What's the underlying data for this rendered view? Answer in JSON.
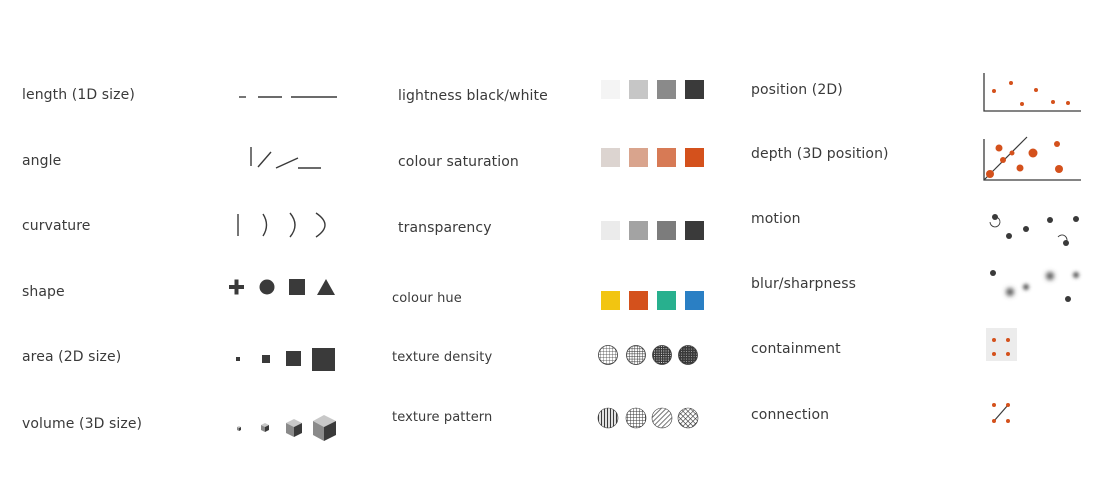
{
  "column1": {
    "labels": [
      "length (1D size)",
      "angle",
      "curvature",
      "shape",
      "area (2D size)",
      "volume (3D size)"
    ]
  },
  "column2": {
    "labels": [
      "lightness black/white",
      "colour saturation",
      "transparency",
      "colour hue",
      "texture density",
      "texture pattern"
    ]
  },
  "column3": {
    "labels": [
      "position (2D)",
      "depth (3D position)",
      "motion",
      "blur/sharpness",
      "containment",
      "connection"
    ]
  },
  "colors": {
    "ink": "#3a3a3a",
    "accent": "#d4511c",
    "lightness": [
      "#f4f4f4",
      "#c6c6c6",
      "#8a8a8a",
      "#3a3a3a"
    ],
    "saturation": [
      "#dcd4d0",
      "#d9a48d",
      "#d77a55",
      "#d4511c"
    ],
    "transparency": [
      "#ebebeb",
      "#a3a3a3",
      "#7c7c7c",
      "#3a3a3a"
    ],
    "hue": [
      "#f2c511",
      "#d4511c",
      "#28b08e",
      "#2a7fc4"
    ]
  }
}
